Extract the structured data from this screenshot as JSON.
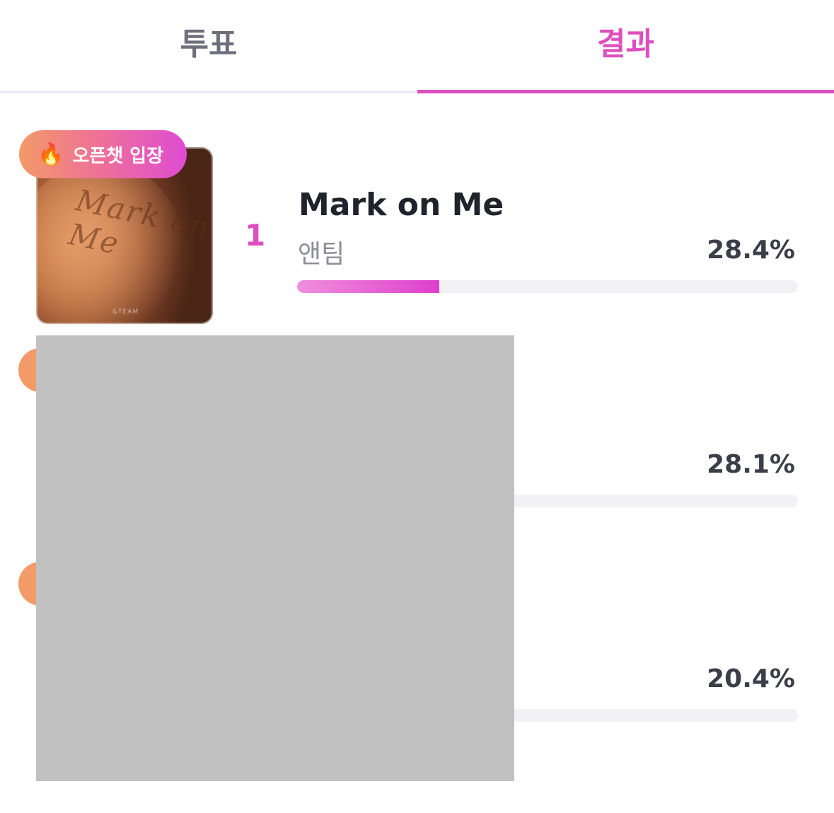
{
  "tabs": {
    "vote_label": "투표",
    "result_label": "결과",
    "active": "result",
    "active_color": "#de4fbe"
  },
  "results": [
    {
      "rank": "1",
      "title": "Mark on Me",
      "artist": "앤팀",
      "percent_label": "28.4%",
      "percent": 28.4,
      "badge": {
        "icon": "fire-icon",
        "label": "오픈챗 입장"
      }
    },
    {
      "rank": "",
      "title": "",
      "artist": "",
      "percent_label": "28.1%",
      "percent": 28.1
    },
    {
      "rank": "",
      "title": "",
      "artist": "",
      "percent_label": "20.4%",
      "percent": 20.4
    }
  ],
  "colors": {
    "accent": "#de4fbe",
    "badge_gradient_start": "#f29a68",
    "badge_gradient_end": "#de4cd2",
    "redaction": "#c1c1c1"
  }
}
